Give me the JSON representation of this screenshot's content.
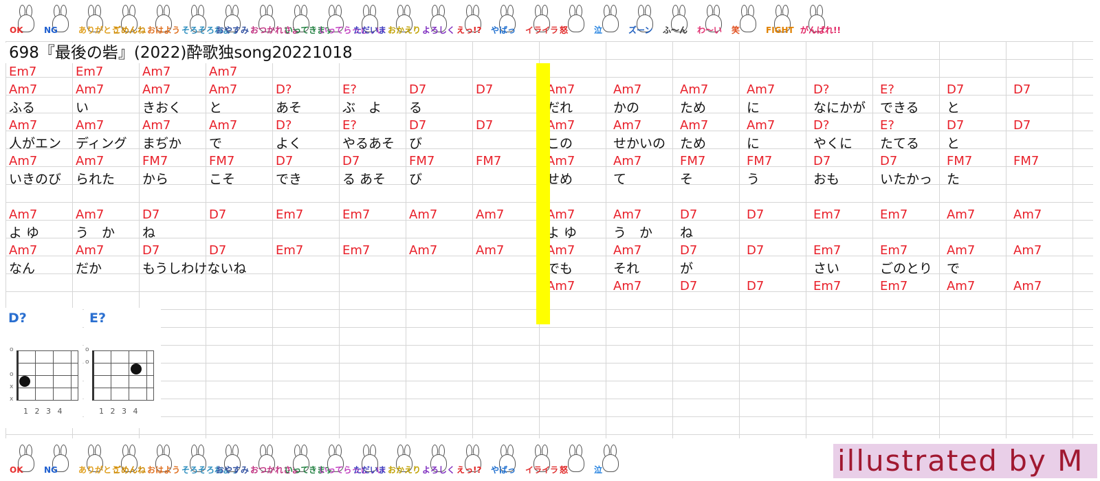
{
  "title": "698『最後の砦』(2022)酔歌独song20221018",
  "credit": "illustrated by M",
  "stickers": [
    {
      "icon": "rabbit-ok-icon",
      "text": "OK",
      "color": "#e83030"
    },
    {
      "icon": "rabbit-ng-icon",
      "text": "NG",
      "color": "#2060d0"
    },
    {
      "icon": "rabbit-yoroshiku-icon",
      "text": "ありがとう",
      "color": "#e0a020"
    },
    {
      "icon": "rabbit-gomen-icon",
      "text": "ごめんね",
      "color": "#cc8800"
    },
    {
      "icon": "rabbit-sun-icon",
      "text": "おはよう",
      "color": "#e07020"
    },
    {
      "icon": "rabbit-moon-icon",
      "text": "そろそろねよう",
      "color": "#3090c0"
    },
    {
      "icon": "rabbit-oyasumi-icon",
      "text": "おやすみ",
      "color": "#3050a0"
    },
    {
      "icon": "rabbit-otsukare-icon",
      "text": "おつかれさま",
      "color": "#c03080"
    },
    {
      "icon": "rabbit-ittekimasu-icon",
      "text": "いってきます",
      "color": "#208040"
    },
    {
      "icon": "rabbit-itterasshai-icon",
      "text": "いってらっしゃい",
      "color": "#c040c0"
    },
    {
      "icon": "rabbit-tadaima-icon",
      "text": "ただいま",
      "color": "#4040c0"
    },
    {
      "icon": "rabbit-okaeri-icon",
      "text": "おかえり",
      "color": "#c0a000"
    },
    {
      "icon": "rabbit-yoroshiku2-icon",
      "text": "よろしく",
      "color": "#8030c0"
    },
    {
      "icon": "rabbit-e-icon",
      "text": "えっ!?",
      "color": "#e02020"
    },
    {
      "icon": "rabbit-yaba-icon",
      "text": "やばっ",
      "color": "#2070d0"
    },
    {
      "icon": "rabbit-iraira-icon",
      "text": "イライラ",
      "color": "#e03030"
    },
    {
      "icon": "rabbit-ikari-icon",
      "text": "怒",
      "color": "#e02020"
    },
    {
      "icon": "rabbit-naki-icon",
      "text": "泣",
      "color": "#2080e0"
    },
    {
      "icon": "rabbit-zuun-icon",
      "text": "ズーン",
      "color": "#2060c0"
    },
    {
      "icon": "rabbit-hn-icon",
      "text": "ふ〜ん",
      "color": "#333333"
    },
    {
      "icon": "rabbit-waai-icon",
      "text": "わ〜い",
      "color": "#e03070"
    },
    {
      "icon": "rabbit-warai-icon",
      "text": "笑",
      "color": "#e05020"
    },
    {
      "icon": "rabbit-fight-icon",
      "text": "FIGHT",
      "color": "#e08000"
    },
    {
      "icon": "rabbit-ganbare-icon",
      "text": "がんばれ!!",
      "color": "#e02060"
    }
  ],
  "rows": [
    {
      "type": "chord",
      "left": [
        "Em7",
        "Em7",
        "Am7",
        "Am7",
        "",
        "",
        "",
        ""
      ],
      "right": [
        "",
        "",
        "",
        "",
        "",
        "",
        "",
        ""
      ]
    },
    {
      "type": "chord",
      "left": [
        "Am7",
        "Am7",
        "Am7",
        "Am7",
        "D?",
        "E?",
        "D7",
        "D7"
      ],
      "right": [
        "Am7",
        "Am7",
        "Am7",
        "Am7",
        "D?",
        "E?",
        "D7",
        "D7"
      ]
    },
    {
      "type": "lyric",
      "left": [
        "ふる",
        "い",
        "きおく",
        "と",
        "あそ",
        "ぶ　よ",
        "る",
        ""
      ],
      "right": [
        "だれ",
        "かの",
        "ため",
        "に",
        "なにかが",
        "できる",
        "と",
        ""
      ]
    },
    {
      "type": "chord",
      "left": [
        "Am7",
        "Am7",
        "Am7",
        "Am7",
        "D?",
        "E?",
        "D7",
        "D7"
      ],
      "right": [
        "Am7",
        "Am7",
        "Am7",
        "Am7",
        "D?",
        "E?",
        "D7",
        "D7"
      ]
    },
    {
      "type": "lyric",
      "left": [
        "人がエン",
        "ディング",
        "まぢか",
        "で",
        "よく",
        "やるあそ",
        "び",
        ""
      ],
      "right": [
        "この",
        "せかいの",
        "ため",
        "に",
        "やくに",
        "たてる",
        "と",
        ""
      ]
    },
    {
      "type": "chord",
      "left": [
        "Am7",
        "Am7",
        "FM7",
        "FM7",
        "D7",
        "D7",
        "FM7",
        "FM7"
      ],
      "right": [
        "Am7",
        "Am7",
        "FM7",
        "FM7",
        "D7",
        "D7",
        "FM7",
        "FM7"
      ]
    },
    {
      "type": "lyric",
      "left": [
        "いきのび",
        "られた",
        "から",
        "こそ",
        "でき",
        "る あそ",
        "び",
        ""
      ],
      "right": [
        "せめ",
        "て",
        "そ",
        "う",
        "おも",
        "いたかっ",
        "た",
        ""
      ]
    },
    {
      "type": "blank",
      "left": [
        "",
        "",
        "",
        "",
        "",
        "",
        "",
        ""
      ],
      "right": [
        "",
        "",
        "",
        "",
        "",
        "",
        "",
        ""
      ]
    },
    {
      "type": "chord",
      "left": [
        "Am7",
        "Am7",
        "D7",
        "D7",
        "Em7",
        "Em7",
        "Am7",
        "Am7"
      ],
      "right": [
        "Am7",
        "Am7",
        "D7",
        "D7",
        "Em7",
        "Em7",
        "Am7",
        "Am7"
      ]
    },
    {
      "type": "lyric",
      "left": [
        "よ ゆ",
        "う　か",
        "ね",
        "",
        "",
        "",
        "",
        ""
      ],
      "right": [
        "よ ゆ",
        "う　か",
        "ね",
        "",
        "",
        "",
        "",
        ""
      ]
    },
    {
      "type": "chord",
      "left": [
        "Am7",
        "Am7",
        "D7",
        "D7",
        "Em7",
        "Em7",
        "Am7",
        "Am7"
      ],
      "right": [
        "Am7",
        "Am7",
        "D7",
        "D7",
        "Em7",
        "Em7",
        "Am7",
        "Am7"
      ]
    },
    {
      "type": "lyric",
      "left": [
        "なん",
        "だか",
        "もうしわけないね",
        "",
        "",
        "",
        "",
        ""
      ],
      "right": [
        "でも",
        "それ",
        "が",
        "",
        "さい",
        "ごのとり",
        "で",
        ""
      ]
    },
    {
      "type": "chord",
      "left": [
        "",
        "",
        "",
        "",
        "",
        "",
        "",
        ""
      ],
      "right": [
        "Am7",
        "Am7",
        "D7",
        "D7",
        "Em7",
        "Em7",
        "Am7",
        "Am7"
      ]
    }
  ],
  "chord_charts": [
    {
      "name": "D?",
      "dot": {
        "string": 3,
        "fret": 1
      },
      "markers": [
        "o",
        "",
        "o",
        "x",
        "x"
      ],
      "fret_numbers": "1 2 3 4"
    },
    {
      "name": "E?",
      "dot": {
        "string": 2,
        "fret": 3
      },
      "markers": [
        "o",
        "o",
        "",
        "",
        ""
      ],
      "fret_numbers": "1 2 3 4"
    }
  ]
}
